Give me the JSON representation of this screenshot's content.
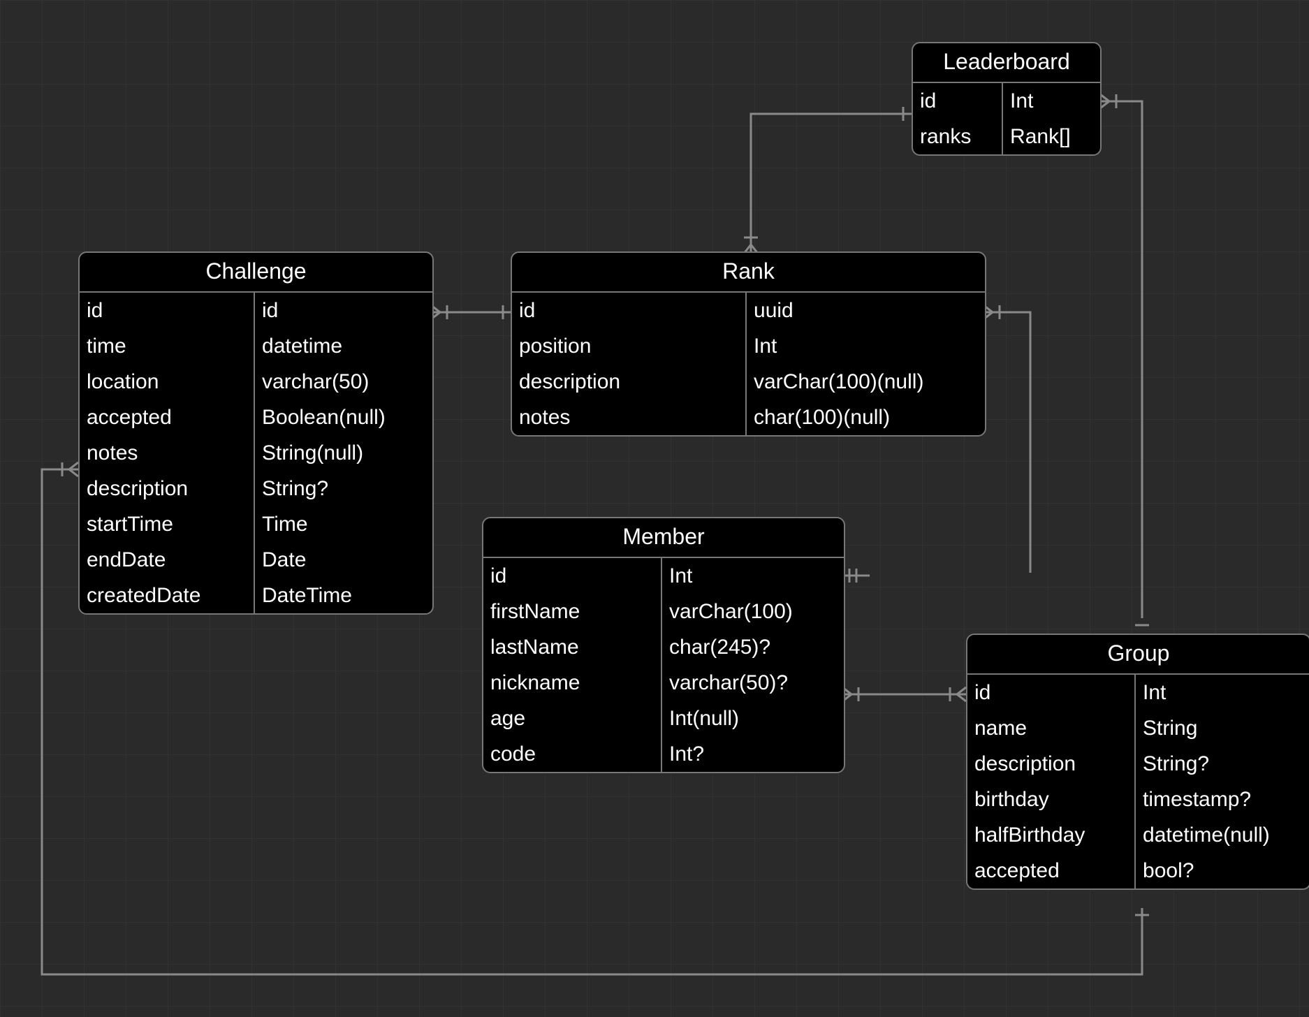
{
  "diagram_type": "entity-relationship",
  "entities": {
    "challenge": {
      "title": "Challenge",
      "rows": [
        {
          "name": "id",
          "type": "id"
        },
        {
          "name": "time",
          "type": "datetime"
        },
        {
          "name": "location",
          "type": "varchar(50)"
        },
        {
          "name": "accepted",
          "type": "Boolean(null)"
        },
        {
          "name": "notes",
          "type": "String(null)"
        },
        {
          "name": "description",
          "type": "String?"
        },
        {
          "name": "startTime",
          "type": "Time"
        },
        {
          "name": "endDate",
          "type": "Date"
        },
        {
          "name": "createdDate",
          "type": "DateTime"
        }
      ]
    },
    "rank": {
      "title": "Rank",
      "rows": [
        {
          "name": "id",
          "type": "uuid"
        },
        {
          "name": "position",
          "type": "Int"
        },
        {
          "name": "description",
          "type": "varChar(100)(null)"
        },
        {
          "name": "notes",
          "type": "char(100)(null)"
        }
      ]
    },
    "leaderboard": {
      "title": "Leaderboard",
      "rows": [
        {
          "name": "id",
          "type": "Int"
        },
        {
          "name": "ranks",
          "type": "Rank[]"
        }
      ]
    },
    "member": {
      "title": "Member",
      "rows": [
        {
          "name": "id",
          "type": "Int"
        },
        {
          "name": "firstName",
          "type": "varChar(100)"
        },
        {
          "name": "lastName",
          "type": "char(245)?"
        },
        {
          "name": "nickname",
          "type": "varchar(50)?"
        },
        {
          "name": "age",
          "type": "Int(null)"
        },
        {
          "name": "code",
          "type": "Int?"
        }
      ]
    },
    "group": {
      "title": "Group",
      "rows": [
        {
          "name": "id",
          "type": "Int"
        },
        {
          "name": "name",
          "type": "String"
        },
        {
          "name": "description",
          "type": "String?"
        },
        {
          "name": "birthday",
          "type": "timestamp?"
        },
        {
          "name": "halfBirthday",
          "type": "datetime(null)"
        },
        {
          "name": "accepted",
          "type": "bool?"
        }
      ]
    }
  },
  "chart_data": {
    "type": "table",
    "note": "ER diagram; each entity is a table with column name/type pairs",
    "relationships": [
      {
        "from": "Challenge",
        "to": "Rank"
      },
      {
        "from": "Rank",
        "to": "Leaderboard"
      },
      {
        "from": "Rank",
        "to": "Group"
      },
      {
        "from": "Member",
        "to": "Group"
      },
      {
        "from": "Challenge",
        "to": "Group"
      },
      {
        "from": "Leaderboard",
        "to": "Group"
      }
    ]
  }
}
